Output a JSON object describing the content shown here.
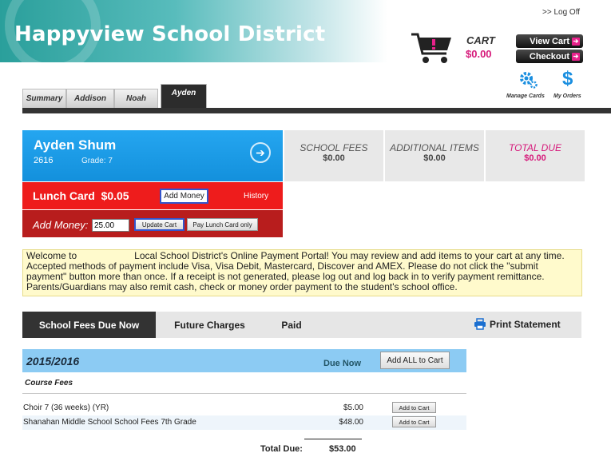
{
  "header": {
    "district_name": "Happyview School District",
    "log_off": ">> Log Off",
    "cart_label": "CART",
    "cart_amount": "$0.00",
    "view_cart": "View Cart",
    "checkout": "Checkout",
    "manage_cards": "Manage Cards",
    "my_orders": "My Orders"
  },
  "tabs": [
    "Summary",
    "Addison",
    "Noah",
    "Ayden"
  ],
  "active_tab": "Ayden",
  "student": {
    "name": "Ayden Shum",
    "id": "2616",
    "grade": "Grade: 7"
  },
  "fees": {
    "school_fees_label": "SCHOOL FEES",
    "school_fees_value": "$0.00",
    "additional_label": "ADDITIONAL ITEMS",
    "additional_value": "$0.00",
    "total_label": "TOTAL DUE",
    "total_value": "$0.00"
  },
  "lunch": {
    "label": "Lunch Card",
    "balance": "$0.05",
    "add_money_button": "Add Money",
    "history": "History",
    "add_money_label": "Add Money:",
    "amount_value": "25.00",
    "update_cart": "Update Cart",
    "pay_lunch_only": "Pay Lunch Card only"
  },
  "notice": {
    "prefix": "Welcome to",
    "text": "Local School District's Online Payment Portal! You may review and add items to your cart at any time. Accepted methods of payment include Visa, Visa Debit, Mastercard, Discover and AMEX. Please do not click the \"submit payment\" button more than once. If a receipt is not generated, please log out and log back in to verify payment remittance. Parents/Guardians may also remit cash, check or money order payment to the student's school office."
  },
  "fee_tabs": [
    "School Fees Due Now",
    "Future Charges",
    "Paid"
  ],
  "print_statement": "Print Statement",
  "fee_table": {
    "year": "2015/2016",
    "due_now_header": "Due Now",
    "add_all": "Add ALL to Cart",
    "section": "Course Fees",
    "rows": [
      {
        "desc": "Choir 7 (36 weeks)  (YR)",
        "amount": "$5.00",
        "button": "Add to Cart"
      },
      {
        "desc": "Shanahan Middle School School Fees 7th Grade",
        "amount": "$48.00",
        "button": "Add to Cart"
      }
    ],
    "total_label": "Total Due:",
    "total_value": "$53.00"
  },
  "colors": {
    "accent_magenta": "#d6197a",
    "student_blue": "#1b9ae6",
    "lunch_red": "#ee1c1c",
    "notice_yellow": "#fffacc"
  }
}
